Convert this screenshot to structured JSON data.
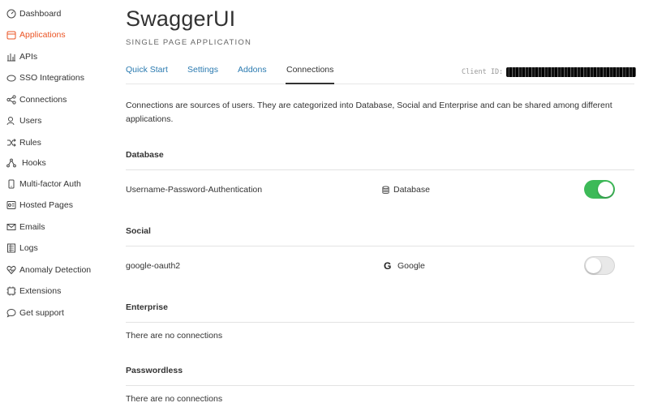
{
  "sidebar": {
    "items": [
      {
        "label": "Dashboard",
        "icon": "dashboard-icon"
      },
      {
        "label": "Applications",
        "icon": "applications-icon",
        "active": true
      },
      {
        "label": "APIs",
        "icon": "apis-icon"
      },
      {
        "label": "SSO Integrations",
        "icon": "sso-icon"
      },
      {
        "label": "Connections",
        "icon": "connections-icon"
      },
      {
        "label": "Users",
        "icon": "users-icon"
      },
      {
        "label": "Rules",
        "icon": "rules-icon"
      },
      {
        "label": "Hooks",
        "icon": "hooks-icon"
      },
      {
        "label": "Multi-factor Auth",
        "icon": "mfa-icon"
      },
      {
        "label": "Hosted Pages",
        "icon": "hosted-pages-icon"
      },
      {
        "label": "Emails",
        "icon": "emails-icon"
      },
      {
        "label": "Logs",
        "icon": "logs-icon"
      },
      {
        "label": "Anomaly Detection",
        "icon": "anomaly-icon"
      },
      {
        "label": "Extensions",
        "icon": "extensions-icon"
      },
      {
        "label": "Get support",
        "icon": "support-icon"
      }
    ]
  },
  "header": {
    "title": "SwaggerUI",
    "app_type": "SINGLE PAGE APPLICATION",
    "client_id_label": "Client ID:"
  },
  "tabs": [
    {
      "label": "Quick Start"
    },
    {
      "label": "Settings"
    },
    {
      "label": "Addons"
    },
    {
      "label": "Connections",
      "active": true
    }
  ],
  "intro": "Connections are sources of users. They are categorized into Database, Social and Enterprise and can be shared among different applications.",
  "sections": {
    "database": {
      "title": "Database",
      "connection_name": "Username-Password-Authentication",
      "type_label": "Database",
      "enabled": true
    },
    "social": {
      "title": "Social",
      "connection_name": "google-oauth2",
      "type_label": "Google",
      "enabled": false
    },
    "enterprise": {
      "title": "Enterprise",
      "empty_text": "There are no connections"
    },
    "passwordless": {
      "title": "Passwordless",
      "empty_text": "There are no connections"
    }
  },
  "colors": {
    "accent": "#eb5424",
    "link": "#2a7ab0",
    "toggle_on": "#3dba58"
  }
}
